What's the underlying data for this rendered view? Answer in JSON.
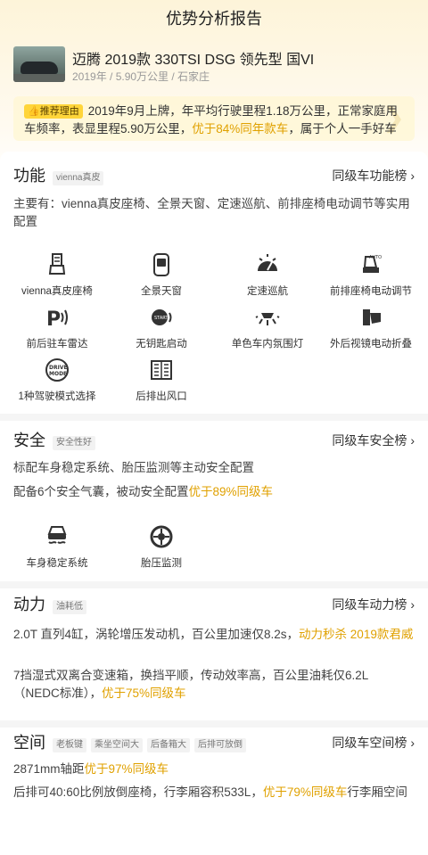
{
  "page": {
    "title": "优势分析报告"
  },
  "car": {
    "name": "迈腾 2019款 330TSI DSG 领先型 国VI",
    "meta": "2019年 / 5.90万公里 / 石家庄"
  },
  "recommend": {
    "tag": "推荐理由",
    "text_before": "2019年9月上牌，年平均行驶里程1.18万公里，正常家庭用车频率，表显里程5.90万公里，",
    "highlight": "优于84%同年款车",
    "text_after": "，属于个人一手好车"
  },
  "function_section": {
    "title": "功能",
    "tags": [
      "vienna真皮"
    ],
    "rank_label": "同级车功能榜",
    "desc": "主要有：vienna真皮座椅、全景天窗、定速巡航、前排座椅电动调节等实用配置",
    "features": [
      {
        "label": "vienna真皮座椅",
        "icon": "leather-seat-icon"
      },
      {
        "label": "全景天窗",
        "icon": "sunroof-icon"
      },
      {
        "label": "定速巡航",
        "icon": "cruise-control-icon"
      },
      {
        "label": "前排座椅电动调节",
        "icon": "power-seat-icon"
      },
      {
        "label": "前后驻车雷达",
        "icon": "parking-radar-icon"
      },
      {
        "label": "无钥匙启动",
        "icon": "keyless-start-icon"
      },
      {
        "label": "单色车内氛围灯",
        "icon": "ambient-light-icon"
      },
      {
        "label": "外后视镜电动折叠",
        "icon": "mirror-fold-icon"
      },
      {
        "label": "1种驾驶模式选择",
        "icon": "drive-mode-icon"
      },
      {
        "label": "后排出风口",
        "icon": "rear-vent-icon"
      }
    ]
  },
  "safety_section": {
    "title": "安全",
    "tags": [
      "安全性好"
    ],
    "rank_label": "同级车安全榜",
    "line1": "标配车身稳定系统、胎压监测等主动安全配置",
    "line2_before": "配备6个安全气囊，被动安全配置",
    "line2_highlight": "优于89%同级车",
    "features": [
      {
        "label": "车身稳定系统",
        "icon": "stability-control-icon"
      },
      {
        "label": "胎压监测",
        "icon": "tire-pressure-icon"
      }
    ]
  },
  "power_section": {
    "title": "动力",
    "tags": [
      "油耗低"
    ],
    "rank_label": "同级车动力榜",
    "p1_before": "2.0T 直列4缸，涡轮增压发动机，百公里加速仅8.2s，",
    "p1_highlight": "动力秒杀 2019款君威",
    "p2_before": "7挡湿式双离合变速箱，换挡平顺，传动效率高，百公里油耗仅6.2L（NEDC标准），",
    "p2_highlight": "优于75%同级车"
  },
  "space_section": {
    "title": "空间",
    "tags": [
      "老板键",
      "乘坐空间大",
      "后备箱大",
      "后排可放倒"
    ],
    "rank_label": "同级车空间榜",
    "p1_before": "2871mm轴距",
    "p1_highlight": "优于97%同级车",
    "p2_before": "后排可40:60比例放倒座椅，行李厢容积533L，",
    "p2_highlight": "优于79%同级车",
    "p2_after": "行李厢空间"
  },
  "colors": {
    "accent": "#e0a100",
    "tag_yellow": "#ffd53a",
    "bg_cream": "#fdf4d9"
  }
}
